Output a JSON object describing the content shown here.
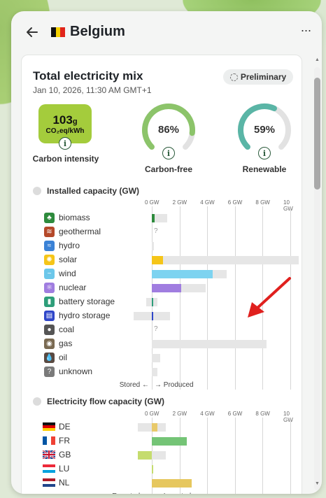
{
  "header": {
    "title": "Belgium",
    "back_icon": "arrow-left-icon",
    "more_icon": "more-horizontal-icon"
  },
  "mix": {
    "title": "Total electricity mix",
    "date": "Jan 10, 2026, 11:30 AM GMT+1",
    "badge": "Preliminary"
  },
  "metrics": {
    "carbon_intensity": {
      "value": "103",
      "value_unit": "g",
      "unit": "CO₂eq/kWh",
      "label": "Carbon intensity",
      "color": "#a4cc3c"
    },
    "carbon_free": {
      "value": "86%",
      "percent": 86,
      "label": "Carbon-free",
      "color": "#8cc46a"
    },
    "renewable": {
      "value": "59%",
      "percent": 59,
      "label": "Renewable",
      "color": "#5ab5a6"
    }
  },
  "installed": {
    "title": "Installed capacity (GW)",
    "ticks": [
      "0 GW",
      "2 GW",
      "4 GW",
      "6 GW",
      "8 GW",
      "10 GW"
    ],
    "footer_left": "Stored ←",
    "footer_right": "→ Produced",
    "rows": [
      {
        "label": "biomass",
        "icon": "biomass-icon",
        "icon_color": "#2e8b3d",
        "glyph": "♣",
        "value": 0.2,
        "capacity": 1.1,
        "bar_color": "#2e8b3d",
        "unknown": ""
      },
      {
        "label": "geothermal",
        "icon": "geothermal-icon",
        "icon_color": "#b5492a",
        "glyph": "≋",
        "value": 0,
        "capacity": 0,
        "bar_color": "#b5492a",
        "unknown": "?"
      },
      {
        "label": "hydro",
        "icon": "hydro-icon",
        "icon_color": "#3b82d6",
        "glyph": "≈",
        "value": 0,
        "capacity": 0.15,
        "bar_color": "#3b82d6",
        "unknown": ""
      },
      {
        "label": "solar",
        "icon": "solar-icon",
        "icon_color": "#f5c518",
        "glyph": "✺",
        "value": 0.8,
        "capacity": 10.6,
        "bar_color": "#f5c518",
        "unknown": ""
      },
      {
        "label": "wind",
        "icon": "wind-icon",
        "icon_color": "#6cc7ea",
        "glyph": "~",
        "value": 4.4,
        "capacity": 5.4,
        "bar_color": "#7dd3f0",
        "unknown": ""
      },
      {
        "label": "nuclear",
        "icon": "nuclear-icon",
        "icon_color": "#a07de0",
        "glyph": "⚛",
        "value": 2.1,
        "capacity": 3.9,
        "bar_color": "#a07de0",
        "unknown": ""
      },
      {
        "label": "battery storage",
        "icon": "battery-storage-icon",
        "icon_color": "#2e9e7a",
        "glyph": "▮",
        "value": 0.05,
        "capacity": 0.4,
        "stored": 0.4,
        "bar_color": "#2e9e7a",
        "unknown": ""
      },
      {
        "label": "hydro storage",
        "icon": "hydro-storage-icon",
        "icon_color": "#2f46c9",
        "glyph": "▤",
        "value": 0.1,
        "capacity": 1.3,
        "stored": 1.3,
        "bar_color": "#2f46c9",
        "unknown": ""
      },
      {
        "label": "coal",
        "icon": "coal-icon",
        "icon_color": "#555555",
        "glyph": "●",
        "value": 0,
        "capacity": 0,
        "bar_color": "#555555",
        "unknown": "?"
      },
      {
        "label": "gas",
        "icon": "gas-icon",
        "icon_color": "#7a6a52",
        "glyph": "◉",
        "value": 0,
        "capacity": 8.3,
        "bar_color": "#7a6a52",
        "unknown": ""
      },
      {
        "label": "oil",
        "icon": "oil-icon",
        "icon_color": "#5a4a42",
        "glyph": "💧",
        "value": 0,
        "capacity": 0.6,
        "bar_color": "#5a4a42",
        "unknown": ""
      },
      {
        "label": "unknown",
        "icon": "unknown-icon",
        "icon_color": "#7a7a7a",
        "glyph": "?",
        "value": 0,
        "capacity": 0.4,
        "bar_color": "#7a7a7a",
        "unknown": ""
      }
    ]
  },
  "flow": {
    "title": "Electricity flow capacity (GW)",
    "ticks": [
      "0 GW",
      "2 GW",
      "4 GW",
      "6 GW",
      "8 GW",
      "10 GW"
    ],
    "footer_left": "Exported ←",
    "footer_right": "→ Imported",
    "rows": [
      {
        "label": "DE",
        "icon": "flag-de-icon",
        "value": 0.4,
        "export_cap": 1.0,
        "import_cap": 1.0,
        "bar_color": "#e8c96a"
      },
      {
        "label": "FR",
        "icon": "flag-fr-icon",
        "value": 2.5,
        "export_cap": 0,
        "import_cap": 2.5,
        "bar_color": "#74c476"
      },
      {
        "label": "GB",
        "icon": "flag-gb-icon",
        "value": -1.0,
        "export_cap": 1.0,
        "import_cap": 1.0,
        "bar_color": "#c5dc6e"
      },
      {
        "label": "LU",
        "icon": "flag-lu-icon",
        "value": 0.05,
        "export_cap": 0,
        "import_cap": 0.1,
        "bar_color": "#c5dc6e"
      },
      {
        "label": "NL",
        "icon": "flag-nl-icon",
        "value": 2.9,
        "export_cap": 0,
        "import_cap": 2.9,
        "bar_color": "#e6c75e"
      }
    ]
  },
  "annotation": {
    "icon": "red-arrow-icon",
    "color": "#e0201e"
  }
}
